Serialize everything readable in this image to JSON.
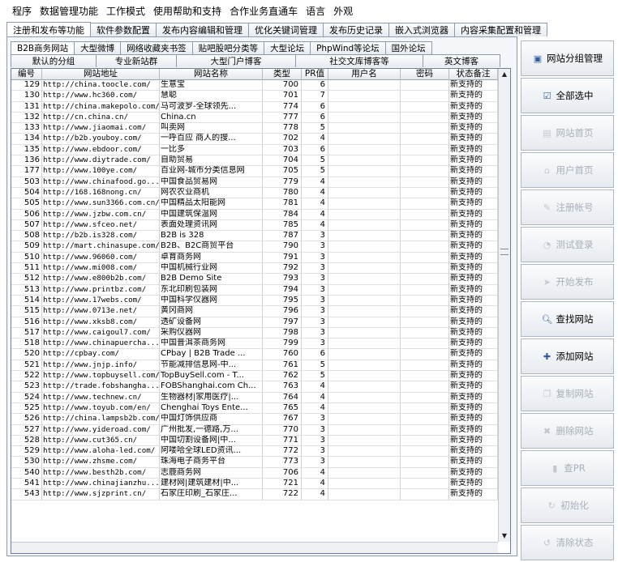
{
  "menu": [
    "程序",
    "数据管理功能",
    "工作模式",
    "使用帮助和支持",
    "合作业务直通车",
    "语言",
    "外观"
  ],
  "main_tabs": [
    "注册和发布等功能",
    "软件参数配置",
    "发布内容编辑和管理",
    "优化关键词管理",
    "发布历史记录",
    "嵌入式浏览器",
    "内容采集配置和管理"
  ],
  "main_tab_active": 0,
  "sub_tabs_row1": [
    "B2B商务网站",
    "大型微博",
    "网络收藏夹书签",
    "贴吧股吧分类等",
    "大型论坛",
    "PhpWind等论坛",
    "国外论坛"
  ],
  "sub_tabs_row2": [
    "默认的分组",
    "专业新站群",
    "大型门户博客",
    "社交文库博客等",
    "英文博客"
  ],
  "table": {
    "headers": [
      "编号",
      "网站地址",
      "网站名称",
      "类型",
      "PR值",
      "用户名",
      "密码",
      "状态备注"
    ],
    "rows": [
      [
        "129",
        "http://china.toocle.com/",
        "生意宝",
        "700",
        "6",
        "",
        "",
        "新支持的"
      ],
      [
        "130",
        "http://www.hc360.com/",
        "慧聪",
        "701",
        "7",
        "",
        "",
        "新支持的"
      ],
      [
        "131",
        "http://china.makepolo.com/",
        "马可波罗-全球领先...",
        "774",
        "6",
        "",
        "",
        "新支持的"
      ],
      [
        "132",
        "http://cn.china.cn/",
        "China.cn",
        "777",
        "6",
        "",
        "",
        "新支持的"
      ],
      [
        "133",
        "http://www.jiaomai.com/",
        "叫卖网",
        "778",
        "5",
        "",
        "",
        "新支持的"
      ],
      [
        "134",
        "http://b2b.youboy.com/",
        "一呼百应 商人的搜...",
        "702",
        "4",
        "",
        "",
        "新支持的"
      ],
      [
        "135",
        "http://www.ebdoor.com/",
        "一比多",
        "703",
        "6",
        "",
        "",
        "新支持的"
      ],
      [
        "136",
        "http://www.diytrade.com/",
        "自助贸易",
        "704",
        "5",
        "",
        "",
        "新支持的"
      ],
      [
        "177",
        "http://www.100ye.com/",
        "百业网-城市分类信息网",
        "705",
        "5",
        "",
        "",
        "新支持的"
      ],
      [
        "503",
        "http://www.chinafood.go...",
        "中国食品贸易网",
        "779",
        "4",
        "",
        "",
        "新支持的"
      ],
      [
        "504",
        "http://168.168nong.cn/",
        "网农农业商机",
        "780",
        "4",
        "",
        "",
        "新支持的"
      ],
      [
        "505",
        "http://www.sun3366.com.cn/",
        "中国精品太阳能网",
        "781",
        "4",
        "",
        "",
        "新支持的"
      ],
      [
        "506",
        "http://www.jzbw.com.cn/",
        "中国建筑保温网",
        "784",
        "4",
        "",
        "",
        "新支持的"
      ],
      [
        "507",
        "http://www.sfceo.net/",
        "表面处理资讯网",
        "785",
        "4",
        "",
        "",
        "新支持的"
      ],
      [
        "508",
        "http://b2b.is328.com/",
        "B2B is 328",
        "787",
        "3",
        "",
        "",
        "新支持的"
      ],
      [
        "509",
        "http://mart.chinasupe.com/",
        "B2B、B2C商贸平台",
        "790",
        "3",
        "",
        "",
        "新支持的"
      ],
      [
        "510",
        "http://www.96060.com/",
        "卓育商务网",
        "791",
        "3",
        "",
        "",
        "新支持的"
      ],
      [
        "511",
        "http://www.mi008.com/",
        "中国机械行业网",
        "792",
        "3",
        "",
        "",
        "新支持的"
      ],
      [
        "512",
        "http://www.e800b2b.com/",
        "B2B Demo Site",
        "793",
        "3",
        "",
        "",
        "新支持的"
      ],
      [
        "513",
        "http://www.printbz.com/",
        "东北印刷包装网",
        "794",
        "3",
        "",
        "",
        "新支持的"
      ],
      [
        "514",
        "http://www.17webs.com/",
        "中国科学仪器网",
        "795",
        "3",
        "",
        "",
        "新支持的"
      ],
      [
        "515",
        "http://www.0713e.net/",
        "黄冈商网",
        "796",
        "3",
        "",
        "",
        "新支持的"
      ],
      [
        "516",
        "http://www.xksb8.com/",
        "透矿设备网",
        "797",
        "3",
        "",
        "",
        "新支持的"
      ],
      [
        "517",
        "http://www.caigoul7.com/",
        "采购仪器网",
        "798",
        "3",
        "",
        "",
        "新支持的"
      ],
      [
        "518",
        "http://www.chinapuercha...",
        "中国普洱茶商务网",
        "799",
        "3",
        "",
        "",
        "新支持的"
      ],
      [
        "520",
        "http://cpbay.com/",
        "CPbay | B2B Trade ...",
        "760",
        "6",
        "",
        "",
        "新支持的"
      ],
      [
        "521",
        "http://www.jnjp.info/",
        "节能减排信息网-中...",
        "761",
        "5",
        "",
        "",
        "新支持的"
      ],
      [
        "522",
        "http://www.topbuysell.com/",
        "TopBuySell.com - T...",
        "762",
        "5",
        "",
        "",
        "新支持的"
      ],
      [
        "523",
        "http://trade.fobshangha...",
        "FOBShanghai.com Ch...",
        "763",
        "4",
        "",
        "",
        "新支持的"
      ],
      [
        "524",
        "http://www.technew.cn/",
        "生物器材|家用医疗|...",
        "764",
        "4",
        "",
        "",
        "新支持的"
      ],
      [
        "525",
        "http://www.toyub.com/en/",
        "Chenghai Toys Ente...",
        "765",
        "4",
        "",
        "",
        "新支持的"
      ],
      [
        "526",
        "http://china.lampsb2b.com/",
        "中国灯饰供应商",
        "767",
        "3",
        "",
        "",
        "新支持的"
      ],
      [
        "527",
        "http://www.yideroad.com/",
        "广州批发,一德路,万...",
        "770",
        "3",
        "",
        "",
        "新支持的"
      ],
      [
        "528",
        "http://www.cut365.cn/",
        "中国切割设备网|中...",
        "771",
        "3",
        "",
        "",
        "新支持的"
      ],
      [
        "529",
        "http://www.aloha-led.com/",
        "阿喽哈全球LED资讯...",
        "772",
        "3",
        "",
        "",
        "新支持的"
      ],
      [
        "530",
        "http://www.zhsme.com/",
        "珠海电子商务平台",
        "773",
        "3",
        "",
        "",
        "新支持的"
      ],
      [
        "540",
        "http://www.besth2b.com/",
        "志鹿商务网",
        "706",
        "4",
        "",
        "",
        "新支持的"
      ],
      [
        "541",
        "http://www.chinajianzhu...",
        "建材网|建筑建材|中...",
        "721",
        "4",
        "",
        "",
        "新支持的"
      ],
      [
        "543",
        "http://www.sjzprint.cn/",
        "石家庄印刷_石家庄...",
        "722",
        "4",
        "",
        "",
        "新支持的"
      ]
    ]
  },
  "sidebar_buttons": [
    {
      "label": "网站分组管理",
      "icon": "group-management-icon",
      "enabled": true
    },
    {
      "label": "全部选中",
      "icon": "select-all-icon",
      "enabled": true
    },
    {
      "label": "网站首页",
      "icon": "site-home-icon",
      "enabled": false
    },
    {
      "label": "用户首页",
      "icon": "user-home-icon",
      "enabled": false
    },
    {
      "label": "注册帐号",
      "icon": "register-account-icon",
      "enabled": false
    },
    {
      "label": "测试登录",
      "icon": "test-login-icon",
      "enabled": false
    },
    {
      "label": "开始发布",
      "icon": "start-publish-icon",
      "enabled": false
    },
    {
      "label": "查找网站",
      "icon": "search-icon",
      "enabled": true
    },
    {
      "label": "添加网站",
      "icon": "add-site-icon",
      "enabled": true
    },
    {
      "label": "复制网站",
      "icon": "copy-site-icon",
      "enabled": false
    },
    {
      "label": "删除网站",
      "icon": "delete-site-icon",
      "enabled": false
    },
    {
      "label": "查PR",
      "icon": "pagerank-icon",
      "enabled": false
    },
    {
      "label": "初始化",
      "icon": "initialize-icon",
      "enabled": false
    },
    {
      "label": "清除状态",
      "icon": "clear-status-icon",
      "enabled": false
    }
  ]
}
